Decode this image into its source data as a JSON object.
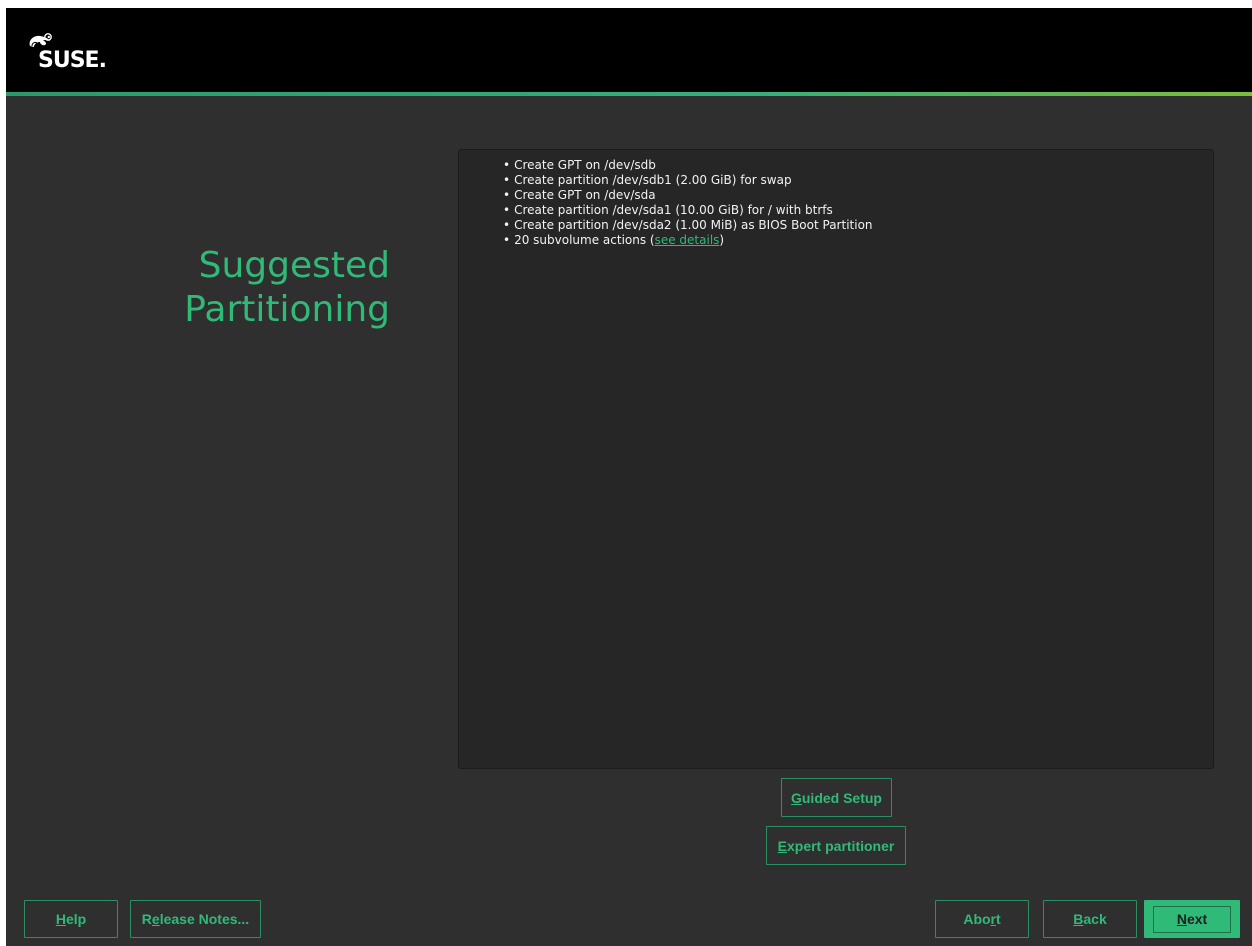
{
  "brand": {
    "logo_text": "SUSE."
  },
  "page": {
    "title_line1": "Suggested",
    "title_line2": "Partitioning"
  },
  "summary": {
    "items": [
      "Create GPT on /dev/sdb",
      "Create partition /dev/sdb1 (2.00 GiB) for swap",
      "Create GPT on /dev/sda",
      "Create partition /dev/sda1 (10.00 GiB) for / with btrfs",
      "Create partition /dev/sda2 (1.00 MiB) as BIOS Boot Partition"
    ],
    "subvolume_prefix": "20 subvolume actions (",
    "subvolume_link": "see details",
    "subvolume_suffix": ")"
  },
  "actions": {
    "guided_setup_mnemonic": "G",
    "guided_setup_rest": "uided Setup",
    "expert_partitioner_mnemonic": "E",
    "expert_partitioner_rest": "xpert partitioner"
  },
  "footer": {
    "help_mnemonic": "H",
    "help_rest": "elp",
    "release_notes_pre": "R",
    "release_notes_mnemonic": "e",
    "release_notes_rest": "lease Notes...",
    "abort_pre": "Abo",
    "abort_mnemonic": "r",
    "abort_rest": "t",
    "back_mnemonic": "B",
    "back_rest": "ack",
    "next_mnemonic": "N",
    "next_rest": "ext"
  },
  "colors": {
    "accent": "#30ba78",
    "background": "#2f2f2f",
    "header": "#000000",
    "panel": "#262626"
  }
}
